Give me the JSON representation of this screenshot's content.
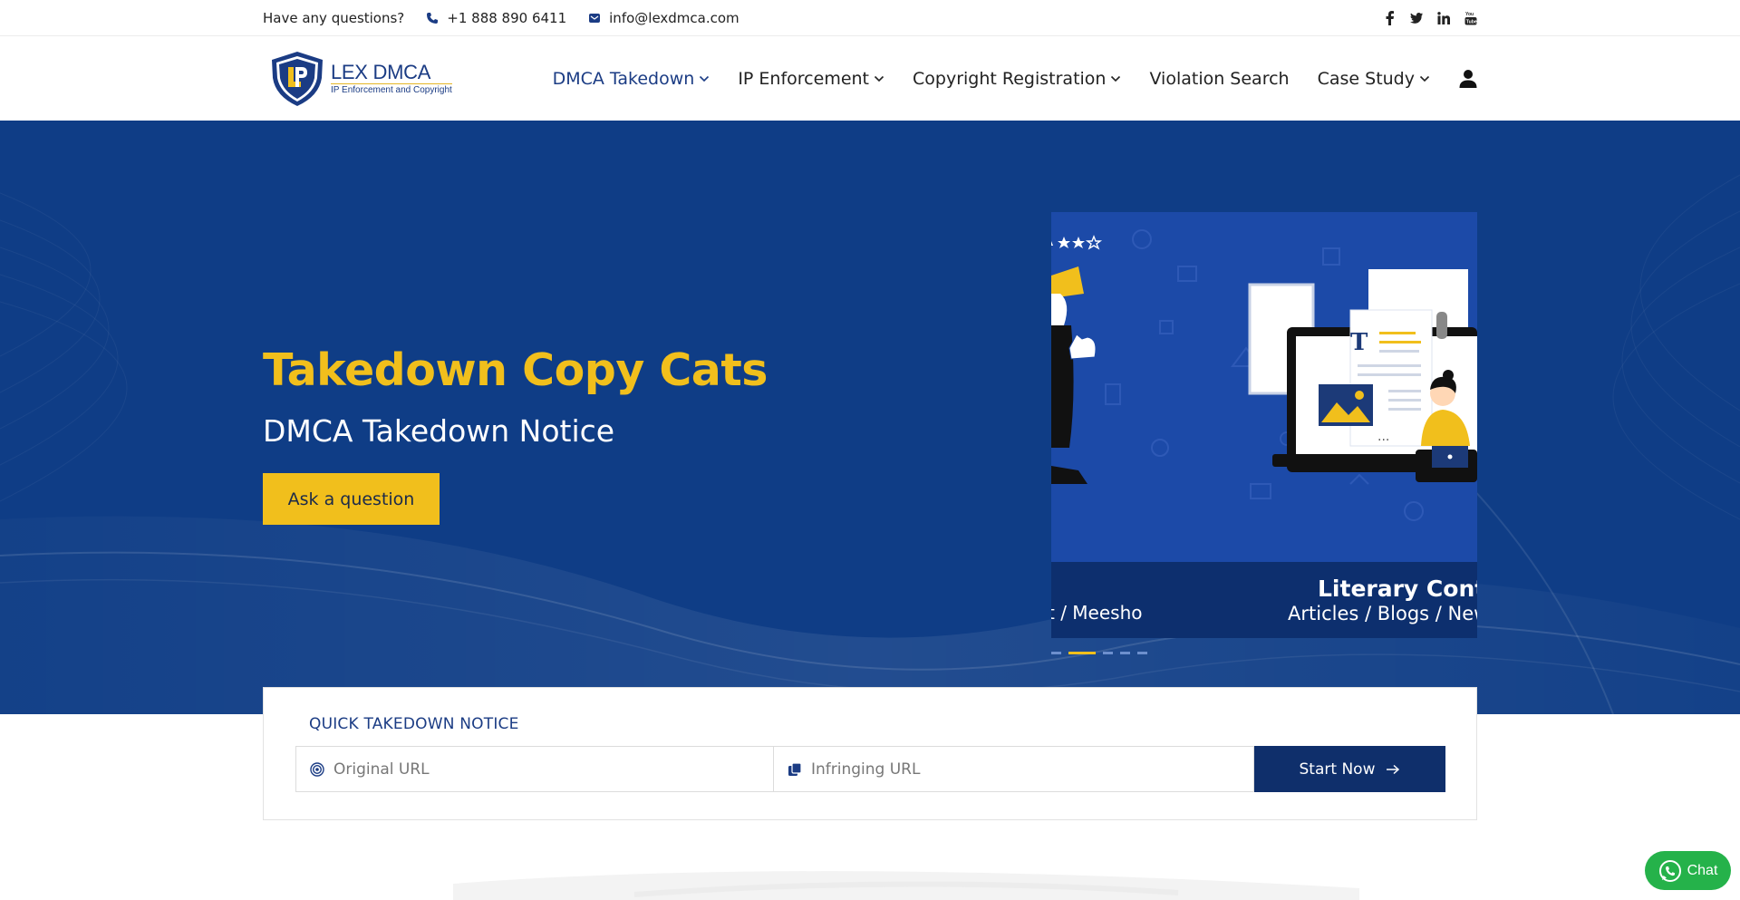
{
  "topbar": {
    "question": "Have any questions?",
    "phone": "+1 888 890 6411",
    "email": "info@lexdmca.com",
    "social": [
      "facebook-icon",
      "twitter-icon",
      "linkedin-icon",
      "youtube-icon"
    ]
  },
  "logo": {
    "brand": "LEX DMCA",
    "tagline": "IP Enforcement and Copyright"
  },
  "nav": {
    "items": [
      {
        "label": "DMCA Takedown",
        "dropdown": true,
        "active": true
      },
      {
        "label": "IP Enforcement",
        "dropdown": true
      },
      {
        "label": "Copyright Registration",
        "dropdown": true
      },
      {
        "label": "Violation Search",
        "dropdown": false
      },
      {
        "label": "Case Study",
        "dropdown": true
      }
    ]
  },
  "hero": {
    "title": "Takedown Copy Cats",
    "subtitle": "DMCA Takedown Notice",
    "cta": "Ask a question"
  },
  "slider": {
    "left_caption": "t / Meesho",
    "right_title": "Literary Conter",
    "right_sub": "Articles / Blogs / New",
    "dots": 5,
    "active_dot": 1
  },
  "quick": {
    "title": "QUICK TAKEDOWN NOTICE",
    "original_placeholder": "Original URL",
    "infringing_placeholder": "Infringing URL",
    "start": "Start Now"
  },
  "chat": {
    "label": "Chat"
  },
  "colors": {
    "primary": "#0f3d86",
    "accent": "#f1bf1c",
    "dark": "#0f2f6b",
    "chat": "#25b24a"
  }
}
